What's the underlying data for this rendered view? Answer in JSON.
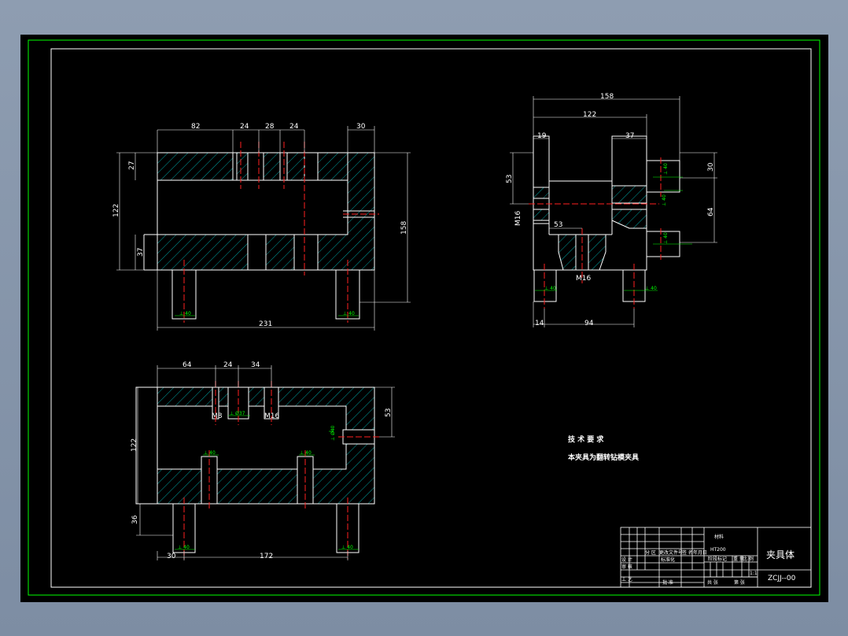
{
  "colors": {
    "background": "#000000",
    "outline": "#ffffff",
    "frame": "#00ff00",
    "hatch": "#00a0a0",
    "centerline": "#ff2020",
    "annotation": "#00ff00"
  },
  "front_view": {
    "dims": {
      "top_82": "82",
      "top_24a": "24",
      "top_28": "28",
      "top_24b": "24",
      "top_30": "30",
      "left_27": "27",
      "left_122": "122",
      "left_37": "37",
      "right_158": "158",
      "bottom_231": "231"
    },
    "tags": {
      "pin_left": "⊥ 40",
      "pin_right": "⊥ 40"
    }
  },
  "side_view": {
    "dims": {
      "top_158": "158",
      "top_122": "122",
      "top_19": "19",
      "top_37": "37",
      "left_53": "53",
      "label_m16_left": "M16",
      "mid_53": "53",
      "label_m16_bottom": "M16",
      "right_30": "30",
      "right_64": "64",
      "bottom_14": "14",
      "bottom_94": "94"
    },
    "tags": {
      "bolt_top": "⊥ 40",
      "bolt_mid": "⊥ 40",
      "bolt_low": "⊥ 40",
      "pin_left": "⊥ 40",
      "pin_right": "⊥ 40"
    }
  },
  "top_view": {
    "dims": {
      "top_64": "64",
      "top_24": "24",
      "top_34": "34",
      "label_m8": "M8",
      "label_m16": "M16",
      "right_53": "53",
      "left_122": "122",
      "left_36": "36",
      "bottom_30": "30",
      "bottom_172": "172"
    },
    "tags": {
      "hole_a": "⊥ Ø37",
      "hole_b": "⊥ 40",
      "hole_c": "⊥ 40",
      "hole_d": "⊥ Ø40",
      "pin_left": "⊥ 40",
      "pin_right": "⊥ 40"
    }
  },
  "notes": {
    "heading": "技 术 要 求",
    "line1": "本夹具为翻转钻模夹具"
  },
  "title_block": {
    "material_label": "材料",
    "material_value": "HT200",
    "part_name": "夹具体",
    "drawing_number": "ZCJJ--00",
    "row_labels": {
      "revise": "分 区",
      "design": "设 计",
      "check": "审 核",
      "craft": "工 艺"
    },
    "col_labels": {
      "mark_no": "更改文件号",
      "sign": "签 名",
      "date": "年月日",
      "std": "标准化",
      "approve": "批 准",
      "stage": "阶段标记",
      "weight": "重 量",
      "scale": "比 例",
      "sheet_total": "共 张",
      "sheet_no": "第 张",
      "scale_value": "1:1"
    }
  }
}
